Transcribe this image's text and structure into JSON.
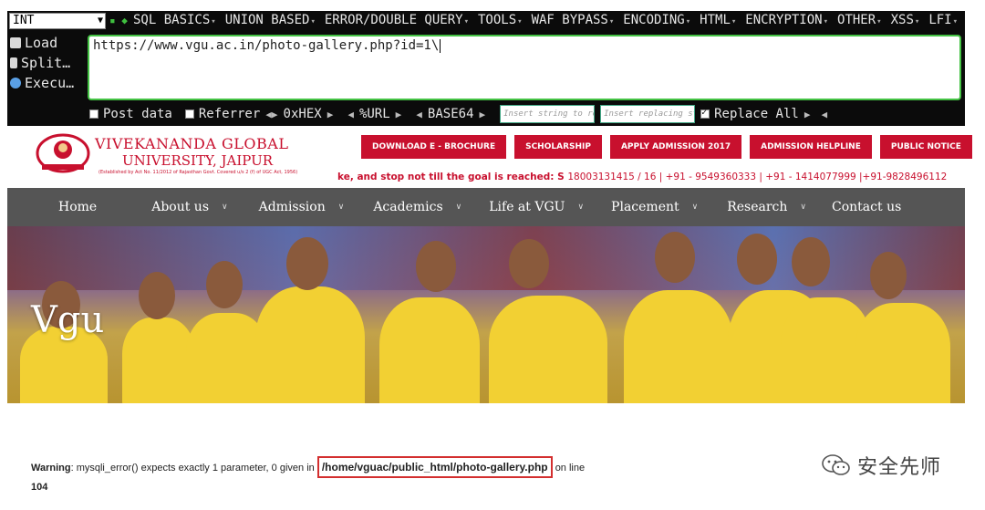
{
  "hackbar": {
    "select_value": "INT",
    "menu": [
      "SQL BASICS",
      "UNION BASED",
      "ERROR/DOUBLE QUERY",
      "TOOLS",
      "WAF BYPASS",
      "ENCODING",
      "HTML",
      "ENCRYPTION",
      "OTHER",
      "XSS",
      "LFI"
    ],
    "buttons": {
      "load": "Load",
      "split": "Split…",
      "execute": "Execu…"
    },
    "url": "https://www.vgu.ac.in/photo-gallery.php?id=1\\",
    "options": {
      "post_data": "Post data",
      "referrer": "Referrer",
      "hex": "0xHEX",
      "url_enc": "%URL",
      "base64": "BASE64",
      "insert_string_placeholder": "Insert string to rep",
      "insert_replacing_placeholder": "Insert replacing str",
      "replace_all": "Replace All"
    }
  },
  "site": {
    "logo_title": "VIVEKANANDA GLOBAL",
    "logo_sub": "UNIVERSITY, JAIPUR",
    "logo_small": "(Established by Act No. 11/2012 of Rajasthan Govt. Covered u/s 2 (f) of UGC Act, 1956)",
    "top_buttons": [
      "DOWNLOAD E - BROCHURE",
      "SCHOLARSHIP",
      "APPLY ADMISSION 2017",
      "ADMISSION HELPLINE",
      "PUBLIC NOTICE"
    ],
    "ticker_text": "ke, and stop not till the goal is reached: S",
    "ticker_phones": "18003131415 / 16 | +91 - 9549360333 | +91 - 1414077999 |+91-9828496112",
    "nav": [
      "Home",
      "About us",
      "Admission",
      "Academics",
      "Life at VGU",
      "Placement",
      "Research",
      "Contact us"
    ],
    "hero_title": "Vgu"
  },
  "warning": {
    "label": "Warning",
    "message": ": mysqli_error() expects exactly 1 parameter, 0 given in",
    "path": "/home/vguac/public_html/photo-gallery.php",
    "suffix": "on line",
    "line": "104"
  },
  "watermark": {
    "text": "安全先师"
  },
  "colors": {
    "brand_red": "#c8102e",
    "nav_gray": "#555555",
    "hackbar_green": "#44c244",
    "highlight_red": "#d32f2f"
  }
}
